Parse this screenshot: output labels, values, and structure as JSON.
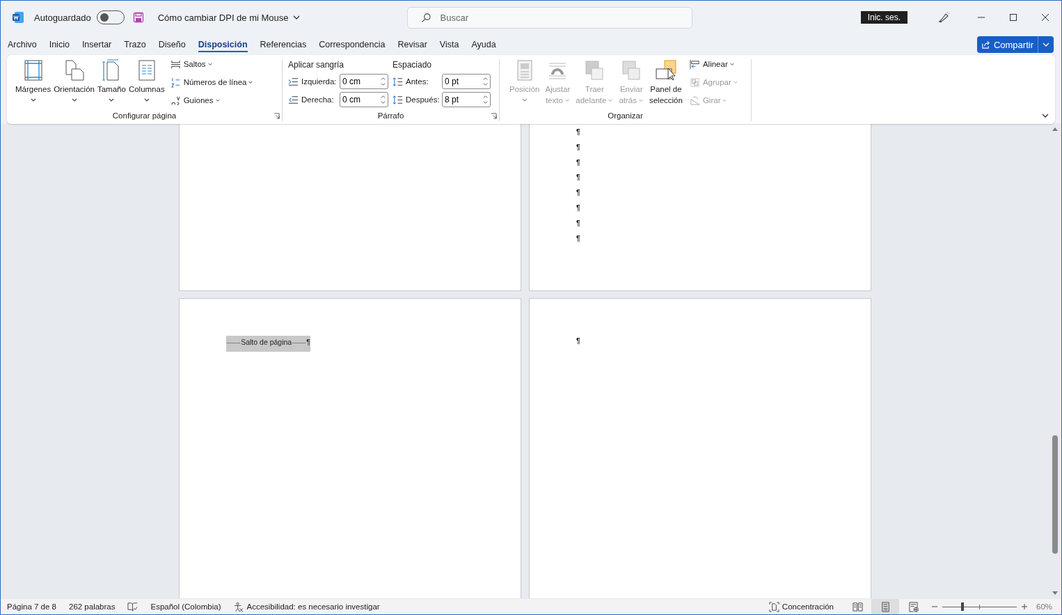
{
  "title_bar": {
    "autosave_label": "Autoguardado",
    "autosave_on": false,
    "document_title": "Cómo cambiar DPI de mi Mouse",
    "search": {
      "placeholder": "Buscar"
    },
    "sign_in": "Inic. ses."
  },
  "tabs": [
    {
      "label": "Archivo",
      "selected": false
    },
    {
      "label": "Inicio",
      "selected": false
    },
    {
      "label": "Insertar",
      "selected": false
    },
    {
      "label": "Trazo",
      "selected": false
    },
    {
      "label": "Diseño",
      "selected": false
    },
    {
      "label": "Disposición",
      "selected": true
    },
    {
      "label": "Referencias",
      "selected": false
    },
    {
      "label": "Correspondencia",
      "selected": false
    },
    {
      "label": "Revisar",
      "selected": false
    },
    {
      "label": "Vista",
      "selected": false
    },
    {
      "label": "Ayuda",
      "selected": false
    }
  ],
  "share_button": "Compartir",
  "ribbon": {
    "page_setup": {
      "label": "Configurar página",
      "large_buttons": [
        "Márgenes",
        "Orientación",
        "Tamaño",
        "Columnas"
      ],
      "small_buttons": [
        "Saltos",
        "Números de línea",
        "Guiones"
      ]
    },
    "paragraph": {
      "label": "Párrafo",
      "indent_title": "Aplicar sangría",
      "spacing_title": "Espaciado",
      "indent": [
        {
          "label": "Izquierda:",
          "value": "0 cm"
        },
        {
          "label": "Derecha:",
          "value": "0 cm"
        }
      ],
      "spacing": [
        {
          "label": "Antes:",
          "value": "0 pt"
        },
        {
          "label": "Después:",
          "value": "8 pt"
        }
      ]
    },
    "arrange": {
      "label": "Organizar",
      "large_buttons": [
        {
          "lines": [
            "Posición"
          ],
          "disabled": true
        },
        {
          "lines": [
            "Ajustar",
            "texto"
          ],
          "disabled": true
        },
        {
          "lines": [
            "Traer",
            "adelante"
          ],
          "disabled": true
        },
        {
          "lines": [
            "Enviar",
            "atrás"
          ],
          "disabled": true
        },
        {
          "lines": [
            "Panel de",
            "selección"
          ],
          "disabled": false
        }
      ],
      "small_buttons": [
        {
          "label": "Alinear",
          "disabled": false
        },
        {
          "label": "Agrupar",
          "disabled": true
        },
        {
          "label": "Girar",
          "disabled": true
        }
      ]
    }
  },
  "page_top_right": {
    "paragraphs": [
      "¶",
      "¶",
      "¶",
      "¶",
      "¶",
      "¶",
      "¶",
      "¶"
    ]
  },
  "page_bottom_left": {
    "page_break": "Salto de página",
    "mark": "¶"
  },
  "page_bottom_right": {
    "paragraphs": [
      "¶"
    ]
  },
  "status_bar": {
    "page": "Página 7 de 8",
    "words": "262 palabras",
    "language": "Español (Colombia)",
    "accessibility": "Accesibilidad: es necesario investigar",
    "focus": "Concentración",
    "views": [
      {
        "selected": false
      },
      {
        "selected": true
      },
      {
        "selected": false
      }
    ],
    "zoom": {
      "level": 0.27,
      "reading": "60%"
    }
  }
}
